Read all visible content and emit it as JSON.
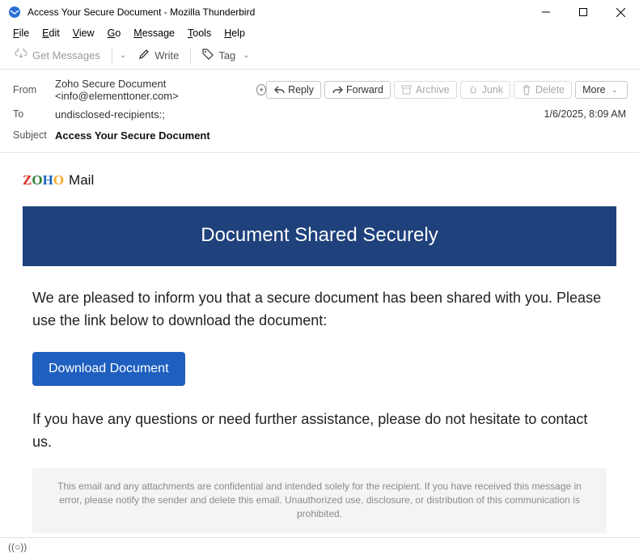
{
  "window": {
    "title": "Access Your Secure Document - Mozilla Thunderbird"
  },
  "menu": {
    "file": "File",
    "edit": "Edit",
    "view": "View",
    "go": "Go",
    "message": "Message",
    "tools": "Tools",
    "help": "Help"
  },
  "toolbar": {
    "get_messages": "Get Messages",
    "write": "Write",
    "tag": "Tag"
  },
  "header": {
    "from_label": "From",
    "from_value": "Zoho Secure Document <info@elementtoner.com>",
    "to_label": "To",
    "to_value": "undisclosed-recipients:;",
    "subject_label": "Subject",
    "subject_value": "Access Your Secure Document",
    "date": "1/6/2025, 8:09 AM"
  },
  "actions": {
    "reply": "Reply",
    "forward": "Forward",
    "archive": "Archive",
    "junk": "Junk",
    "delete": "Delete",
    "more": "More"
  },
  "mail": {
    "logo_z": "Z",
    "logo_o1": "O",
    "logo_h": "H",
    "logo_o2": "O",
    "logo_mail": "Mail",
    "banner": "Document Shared Securely",
    "para1": "We are pleased to inform you that a secure document has been shared with you. Please use the link below to download the document:",
    "download": "Download Document",
    "para2": "If you have any questions or need further assistance, please do not hesitate to contact us.",
    "disclaimer": "This email and any attachments are confidential and intended solely for the recipient. If you have received this message in error, please notify the sender and delete this email. Unauthorized use, disclosure, or distribution of this communication is prohibited."
  },
  "status": {
    "indicator": "((○))"
  }
}
